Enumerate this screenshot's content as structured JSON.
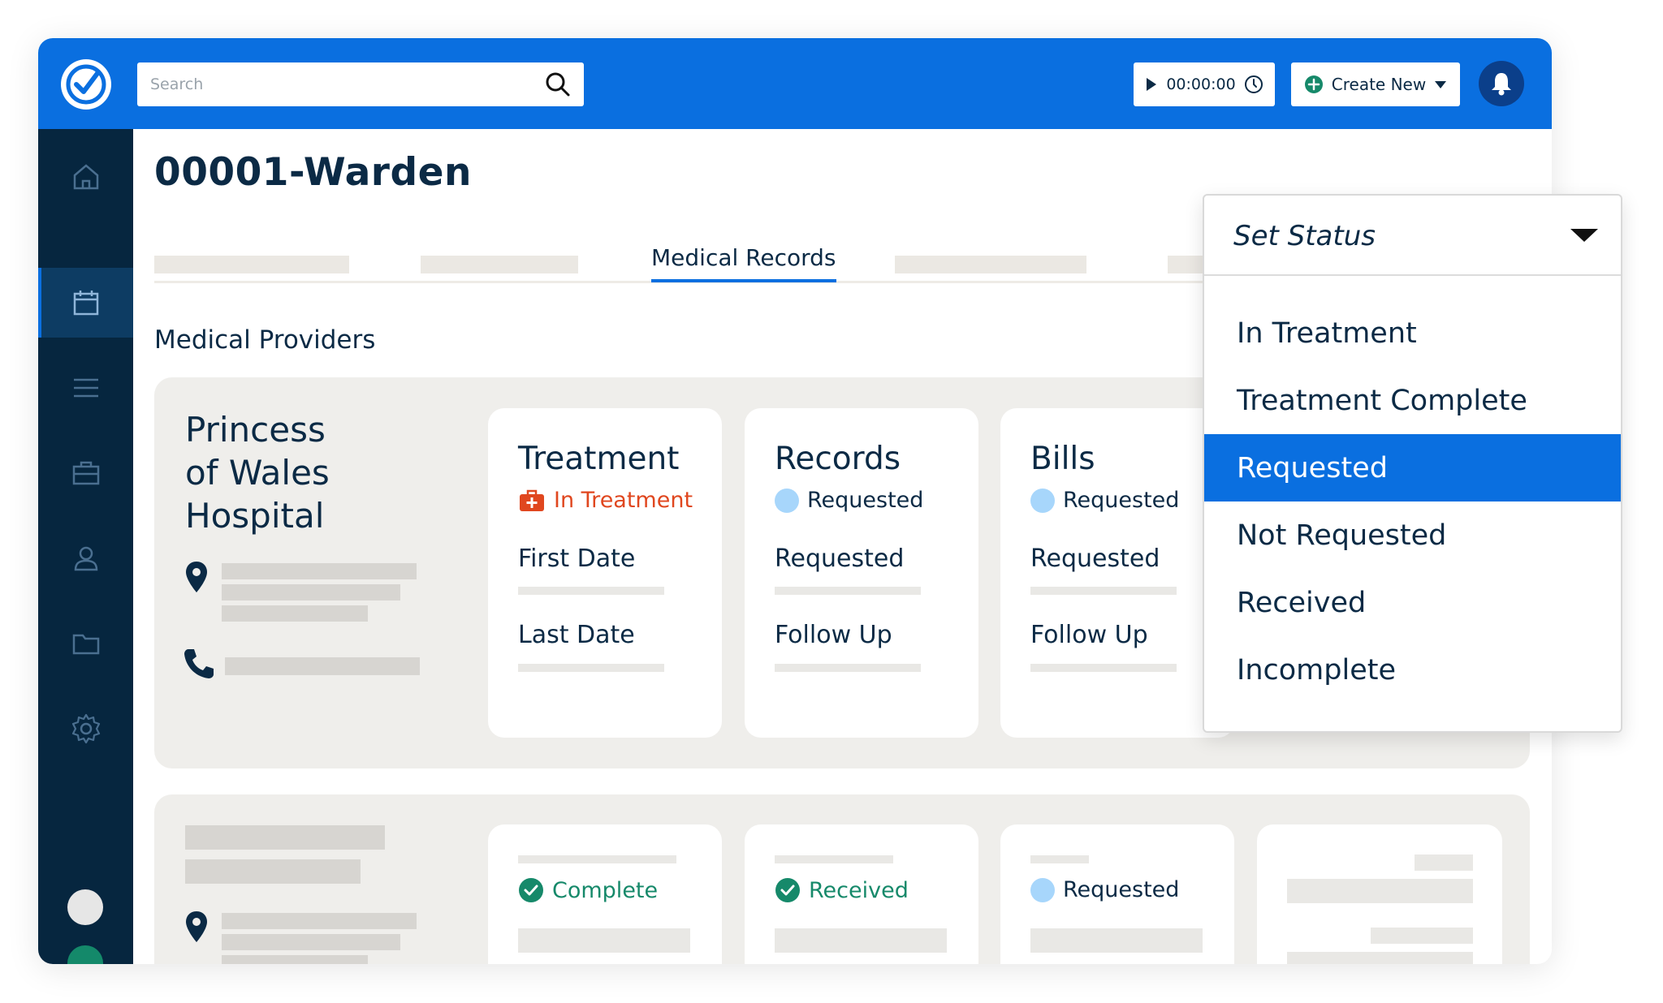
{
  "topbar": {
    "search_placeholder": "Search",
    "timer": "00:00:00",
    "create_label": "Create New"
  },
  "sidebar": {
    "items": [
      "home-icon",
      "calendar-icon",
      "list-icon",
      "briefcase-icon",
      "user-icon",
      "folder-icon",
      "settings-icon"
    ],
    "active": "calendar-icon"
  },
  "page": {
    "case_title": "00001-Warden",
    "active_tab": "Medical Records",
    "section_title": "Medical Providers"
  },
  "provider1": {
    "name_lines": [
      "Princess",
      "of Wales",
      "Hospital"
    ],
    "treatment": {
      "title": "Treatment",
      "status": "In Treatment",
      "first": "First Date",
      "last": "Last Date"
    },
    "records": {
      "title": "Records",
      "status": "Requested",
      "label1": "Requested",
      "label2": "Follow Up"
    },
    "bills": {
      "title": "Bills",
      "status": "Requested",
      "label1": "Requested",
      "label2": "Follow Up"
    }
  },
  "provider2": {
    "status1": "Complete",
    "status2": "Received",
    "status3": "Requested"
  },
  "dropdown": {
    "header": "Set Status",
    "options": [
      "In Treatment",
      "Treatment Complete",
      "Requested",
      "Not Requested",
      "Received",
      "Incomplete"
    ],
    "selected": "Requested"
  },
  "colors": {
    "brand_blue": "#0a6fe0",
    "sidebar_navy": "#06263f",
    "treatment_orange": "#e0471f",
    "complete_green": "#16896a",
    "requested_blue": "#a7d6fb"
  }
}
